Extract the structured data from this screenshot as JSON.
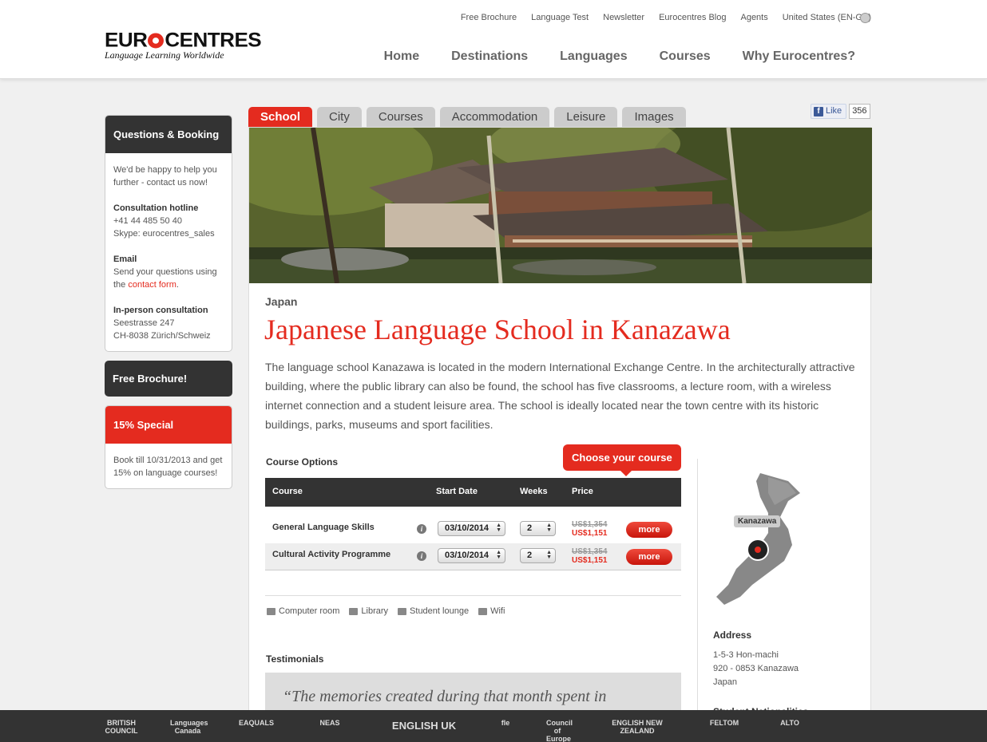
{
  "header": {
    "logo_text": "EUROCENTRES",
    "logo_tagline": "Language Learning Worldwide",
    "util_nav": [
      "Free Brochure",
      "Language Test",
      "Newsletter",
      "Eurocentres Blog",
      "Agents",
      "United States (EN-GB)"
    ],
    "main_nav": [
      "Home",
      "Destinations",
      "Languages",
      "Courses",
      "Why Eurocentres?"
    ]
  },
  "sidebar": {
    "questions": {
      "title": "Questions & Booking",
      "intro": "We'd be happy to help you further - contact us now!",
      "hotline_label": "Consultation hotline",
      "hotline_phone": "+41 44 485 50 40",
      "hotline_skype": "Skype: eurocentres_sales",
      "email_label": "Email",
      "email_text": "Send your questions using the",
      "email_link": "contact form",
      "inperson_label": "In-person consultation",
      "inperson_street": "Seestrasse 247",
      "inperson_city": "CH-8038 Zürich/Schweiz"
    },
    "brochure": "Free Brochure!",
    "special": {
      "title": "15% Special",
      "text": "Book till 10/31/2013 and get 15% on language courses!"
    }
  },
  "tabs": [
    "School",
    "City",
    "Courses",
    "Accommodation",
    "Leisure",
    "Images"
  ],
  "facebook": {
    "like": "Like",
    "count": "356"
  },
  "school": {
    "country": "Japan",
    "title": "Japanese Language School in Kanazawa",
    "description": "The language school Kanazawa is located in the modern International Exchange Centre. In the architecturally attractive building, where the public library can also be found, the school has five classrooms, a lecture room, with a wireless internet connection and a student leisure area. The school is ideally located near the town centre with its historic buildings, parks, museums and sport facilities."
  },
  "course_options": {
    "title": "Course Options",
    "choose_label": "Choose your course",
    "headers": [
      "Course",
      "Start Date",
      "Weeks",
      "Price"
    ],
    "rows": [
      {
        "name": "General Language Skills",
        "start": "03/10/2014",
        "weeks": "2",
        "old_price": "US$1,354",
        "new_price": "US$1,151",
        "button": "more"
      },
      {
        "name": "Cultural Activity Programme",
        "start": "03/10/2014",
        "weeks": "2",
        "old_price": "US$1,354",
        "new_price": "US$1,151",
        "button": "more"
      }
    ]
  },
  "facilities": [
    "Computer room",
    "Library",
    "Student lounge",
    "Wifi"
  ],
  "testimonials": {
    "title": "Testimonials",
    "quote": "“The memories created during that month spent in"
  },
  "map": {
    "city_label": "Kanazawa"
  },
  "address": {
    "title": "Address",
    "line1": "1-5-3 Hon-machi",
    "line2": "920 - 0853 Kanazawa",
    "line3": "Japan"
  },
  "student_nationalities_title": "Student Nationalities",
  "footer_logos": [
    "BRITISH COUNCIL",
    "Languages Canada",
    "EAQUALS",
    "NEAS",
    "ENGLISH UK",
    "fle",
    "Council of Europe",
    "ENGLISH NEW ZEALAND",
    "FELTOM",
    "ALTO"
  ],
  "colors": {
    "accent": "#e42b1f",
    "dark": "#333333"
  }
}
